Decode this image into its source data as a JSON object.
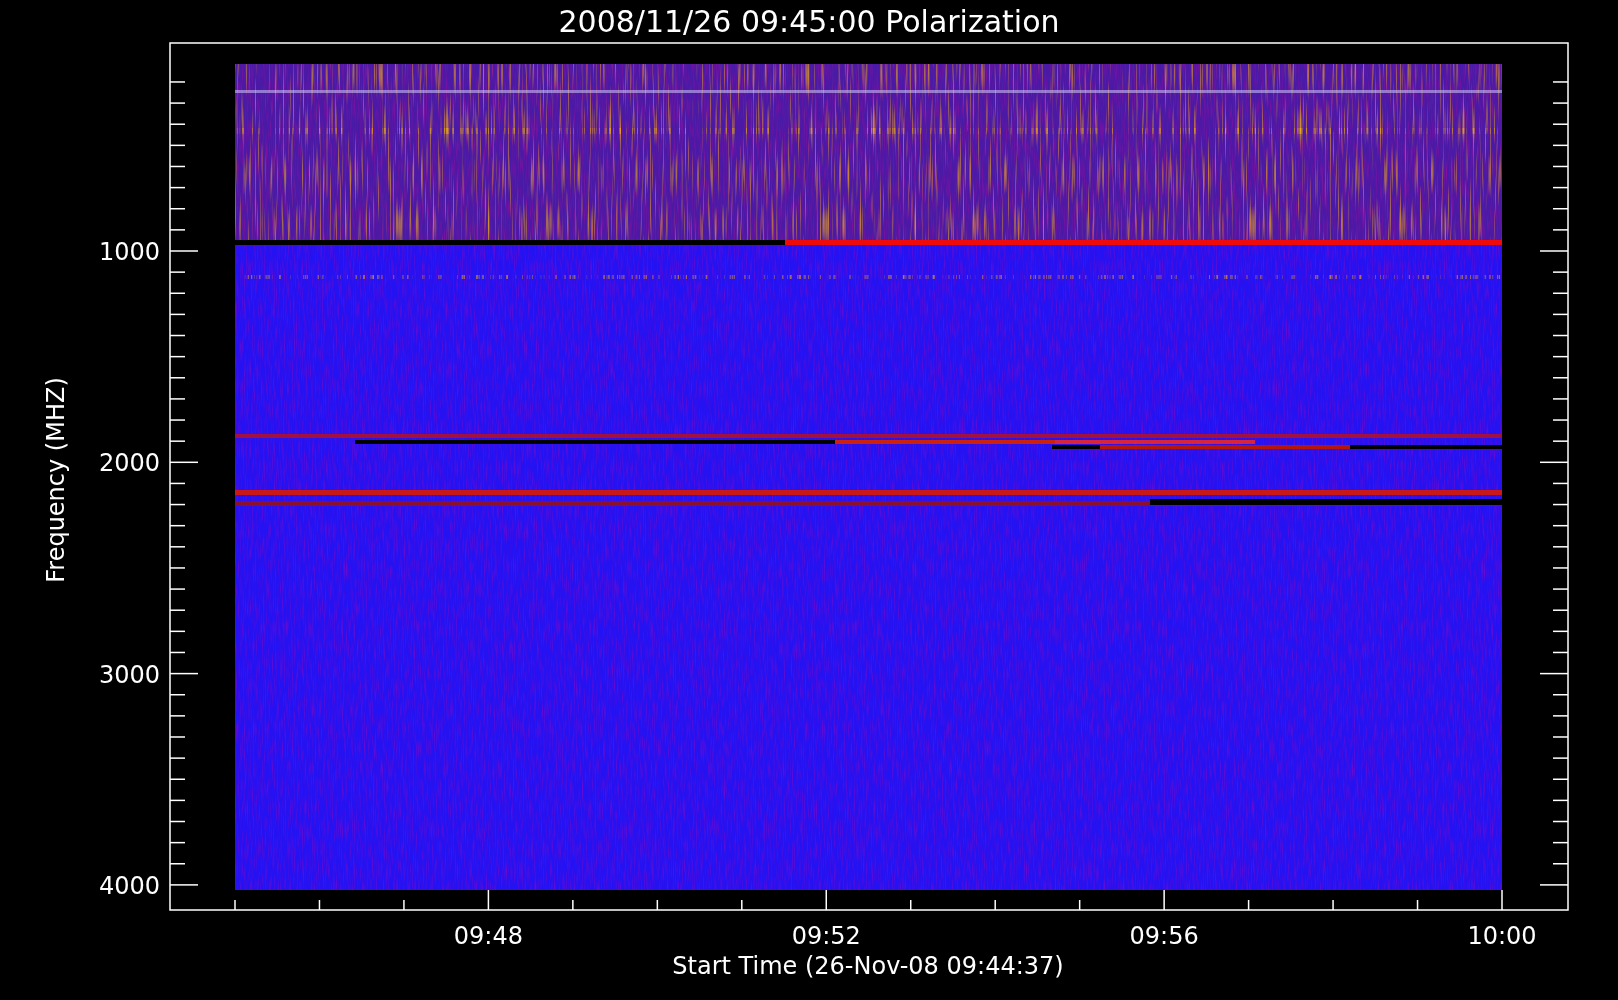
{
  "plot": {
    "title": "2008/11/26 09:45:00 Polarization",
    "y_axis": {
      "label": "Frequency (MHZ)",
      "ticks": [
        "1000",
        "2000",
        "3000",
        "4000"
      ]
    },
    "x_axis": {
      "label": "Start Time (26-Nov-08 09:44:37)",
      "ticks": [
        "09:48",
        "09:52",
        "09:56",
        "10:00"
      ]
    }
  }
}
